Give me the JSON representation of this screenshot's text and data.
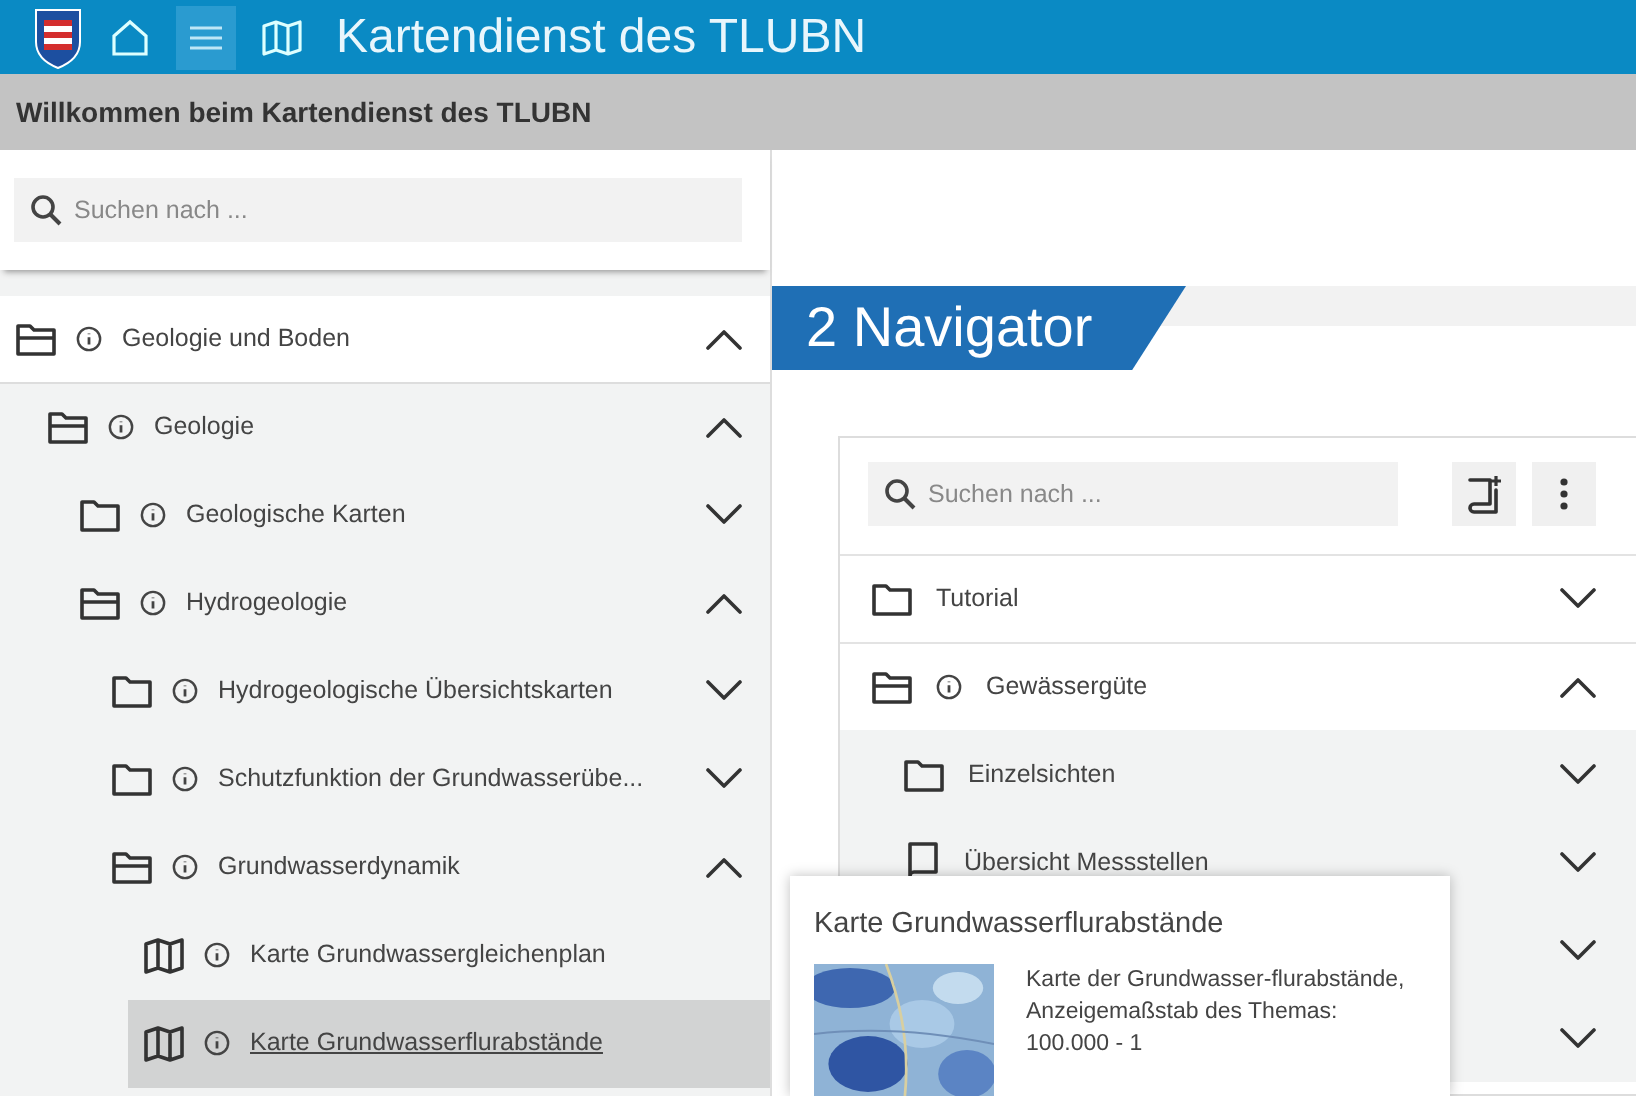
{
  "header": {
    "title": "Kartendienst des TLUBN",
    "menu_active": true
  },
  "welcome": "Willkommen beim Kartendienst des TLUBN",
  "sidebar": {
    "search": {
      "placeholder": "Suchen nach ..."
    },
    "tree": [
      {
        "kind": "folder",
        "label": "Geologie und Boden",
        "info": true,
        "expanded": true,
        "selected": false,
        "children": [
          {
            "kind": "folder",
            "label": "Geologie",
            "info": true,
            "expanded": true,
            "selected": false,
            "children": [
              {
                "kind": "folder",
                "label": "Geologische Karten",
                "info": true,
                "expanded": false,
                "selected": false
              },
              {
                "kind": "folder",
                "label": "Hydrogeologie",
                "info": true,
                "expanded": true,
                "selected": false,
                "children": [
                  {
                    "kind": "folder",
                    "label": "Hydrogeologische Übersichtskarten",
                    "info": true,
                    "expanded": false,
                    "selected": false
                  },
                  {
                    "kind": "folder",
                    "label": "Schutzfunktion der Grundwasserübe...",
                    "info": true,
                    "expanded": false,
                    "selected": false
                  },
                  {
                    "kind": "folder",
                    "label": "Grundwasserdynamik",
                    "info": true,
                    "expanded": true,
                    "selected": false,
                    "children": [
                      {
                        "kind": "map",
                        "label": "Karte Grundwassergleichenplan",
                        "info": true,
                        "selected": false
                      },
                      {
                        "kind": "map",
                        "label": "Karte Grundwasserflurabstände",
                        "info": true,
                        "selected": true
                      }
                    ]
                  }
                ]
              }
            ]
          }
        ]
      }
    ]
  },
  "navigator": {
    "title": "2 Navigator",
    "search": {
      "placeholder": "Suchen nach ..."
    },
    "items": [
      {
        "kind": "folder",
        "label": "Tutorial",
        "info": false,
        "expanded": false
      },
      {
        "kind": "folder",
        "label": "Gewässergüte",
        "info": true,
        "expanded": true,
        "children": [
          {
            "kind": "folder",
            "label": "Einzelsichten",
            "info": false,
            "expanded": false
          },
          {
            "kind": "book",
            "label": "Übersicht Messstellen",
            "info": false,
            "expanded": false
          },
          {
            "kind": "hidden",
            "expanded": false
          },
          {
            "kind": "hidden",
            "expanded": false
          }
        ]
      }
    ]
  },
  "popover": {
    "title": "Karte Grundwasserflurabstände",
    "text": "Karte der Grundwasser-flurabstände, Anzeigemaßstab des Themas: 100.000 - 1"
  }
}
